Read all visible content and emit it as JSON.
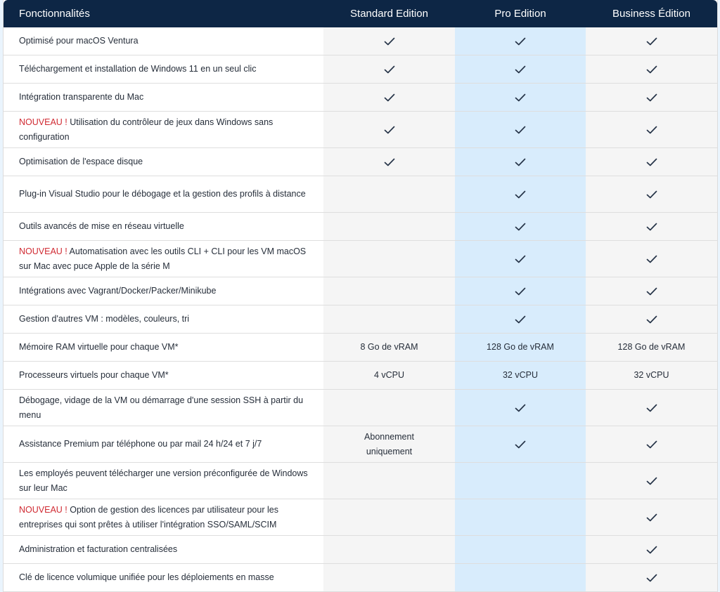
{
  "header": {
    "feature_col": "Fonctionnalités",
    "editions": [
      "Standard Edition",
      "Pro Edition",
      "Business Édition"
    ]
  },
  "colors": {
    "header_bg": "#0d2645",
    "pro_column_bg": "#d8ecfc",
    "new_badge": "#d02a32",
    "check": "#263448"
  },
  "rows": [
    {
      "new": "",
      "label": "Optimisé pour macOS Ventura",
      "standard": "check-icon",
      "pro": "check-icon",
      "business": "check-icon"
    },
    {
      "new": "",
      "label": "Téléchargement et installation de Windows 11 en un seul clic",
      "standard": "check-icon",
      "pro": "check-icon",
      "business": "check-icon"
    },
    {
      "new": "",
      "label": "Intégration transparente du Mac",
      "standard": "check-icon",
      "pro": "check-icon",
      "business": "check-icon"
    },
    {
      "new": "NOUVEAU ! ",
      "label": "Utilisation du contrôleur de jeux dans Windows sans configuration",
      "standard": "check-icon",
      "pro": "check-icon",
      "business": "check-icon"
    },
    {
      "new": "",
      "label": "Optimisation de l'espace disque",
      "standard": "check-icon",
      "pro": "check-icon",
      "business": "check-icon"
    },
    {
      "new": "",
      "label": "Plug-in Visual Studio pour le débogage et la gestion des profils à distance",
      "standard": "",
      "pro": "check-icon",
      "business": "check-icon"
    },
    {
      "new": "",
      "label": "Outils avancés de mise en réseau virtuelle",
      "standard": "",
      "pro": "check-icon",
      "business": "check-icon"
    },
    {
      "new": "NOUVEAU ! ",
      "label": "Automatisation avec les outils CLI + CLI pour les VM macOS sur Mac avec puce Apple de la série M",
      "standard": "",
      "pro": "check-icon",
      "business": "check-icon"
    },
    {
      "new": "",
      "label": "Intégrations avec Vagrant/Docker/Packer/Minikube",
      "standard": "",
      "pro": "check-icon",
      "business": "check-icon"
    },
    {
      "new": "",
      "label": "Gestion d'autres VM : modèles, couleurs, tri",
      "standard": "",
      "pro": "check-icon",
      "business": "check-icon"
    },
    {
      "new": "",
      "label": "Mémoire RAM virtuelle pour chaque VM*",
      "standard": "8 Go de vRAM",
      "pro": "128 Go de vRAM",
      "business": "128 Go de vRAM"
    },
    {
      "new": "",
      "label": "Processeurs virtuels pour chaque VM*",
      "standard": "4 vCPU",
      "pro": "32 vCPU",
      "business": "32 vCPU"
    },
    {
      "new": "",
      "label": "Débogage, vidage de la VM ou démarrage d'une session SSH à partir du menu",
      "standard": "",
      "pro": "check-icon",
      "business": "check-icon"
    },
    {
      "new": "",
      "label": "Assistance Premium par téléphone ou par mail 24 h/24 et 7 j/7",
      "standard": "Abonnement uniquement",
      "pro": "check-icon",
      "business": "check-icon"
    },
    {
      "new": "",
      "label": "Les employés peuvent télécharger une version préconfigurée de Windows sur leur Mac",
      "standard": "",
      "pro": "",
      "business": "check-icon"
    },
    {
      "new": "NOUVEAU ! ",
      "label": "Option de gestion des licences par utilisateur pour les entreprises qui sont prêtes à utiliser l'intégration SSO/SAML/SCIM",
      "standard": "",
      "pro": "",
      "business": "check-icon"
    },
    {
      "new": "",
      "label": "Administration et facturation centralisées",
      "standard": "",
      "pro": "",
      "business": "check-icon"
    },
    {
      "new": "",
      "label": "Clé de licence volumique unifiée pour les déploiements en masse",
      "standard": "",
      "pro": "",
      "business": "check-icon"
    }
  ]
}
